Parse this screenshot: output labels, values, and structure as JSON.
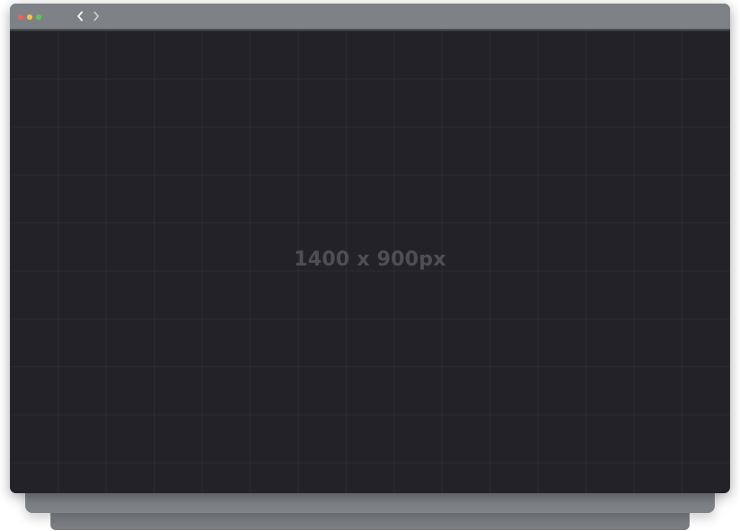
{
  "window": {
    "controls": {
      "close_color": "#f15e55",
      "minimize_color": "#f6c14a",
      "maximize_color": "#5fc85a"
    },
    "nav": {
      "back_icon": "chevron-left-icon",
      "forward_icon": "chevron-right-icon"
    }
  },
  "viewport": {
    "placeholder_label": "1400 x 900px",
    "background_color": "#232327",
    "grid": true
  }
}
